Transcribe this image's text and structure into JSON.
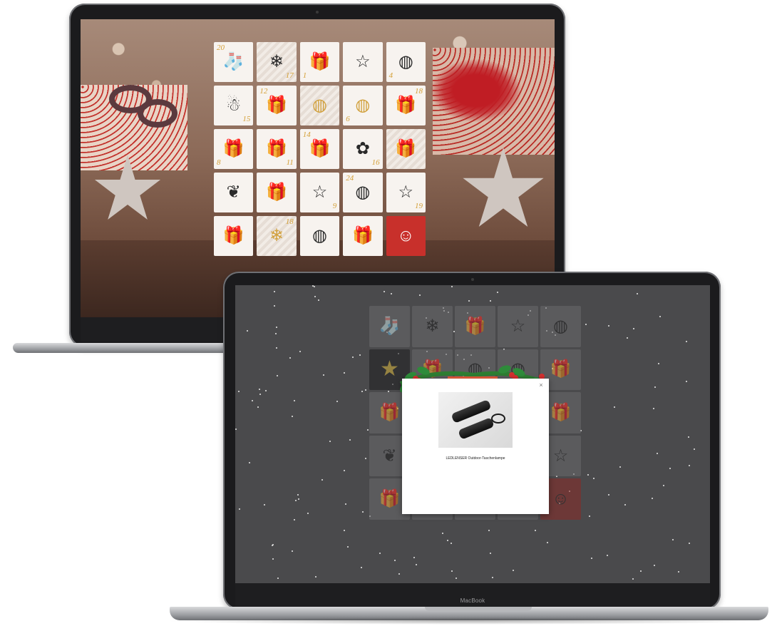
{
  "back_laptop": {
    "calendar": {
      "tiles": [
        {
          "number": "20",
          "icon": "stocking-icon",
          "glyph": "🧦",
          "style": "plain",
          "gold": false
        },
        {
          "number": "17",
          "icon": "ornament-icon",
          "glyph": "❄",
          "style": "striped",
          "gold": false
        },
        {
          "number": "1",
          "icon": "gift-icon",
          "glyph": "🎁",
          "style": "plain",
          "gold": false
        },
        {
          "number": "",
          "icon": "star-icon",
          "glyph": "☆",
          "style": "plain",
          "gold": false
        },
        {
          "number": "4",
          "icon": "bauble-icon",
          "glyph": "◍",
          "style": "plain",
          "gold": false
        },
        {
          "number": "15",
          "icon": "snowman-icon",
          "glyph": "☃",
          "style": "plain",
          "gold": false
        },
        {
          "number": "12",
          "icon": "gift-icon",
          "glyph": "🎁",
          "style": "plain",
          "gold": true
        },
        {
          "number": "",
          "icon": "bauble-icon",
          "glyph": "◍",
          "style": "striped",
          "gold": true
        },
        {
          "number": "6",
          "icon": "bauble-icon",
          "glyph": "◍",
          "style": "plain",
          "gold": true
        },
        {
          "number": "18",
          "icon": "gift-icon",
          "glyph": "🎁",
          "style": "plain",
          "gold": true
        },
        {
          "number": "8",
          "icon": "gift-icon",
          "glyph": "🎁",
          "style": "plain",
          "gold": true
        },
        {
          "number": "11",
          "icon": "gift-icon",
          "glyph": "🎁",
          "style": "plain",
          "gold": false
        },
        {
          "number": "14",
          "icon": "gift-icon",
          "glyph": "🎁",
          "style": "plain",
          "gold": false
        },
        {
          "number": "16",
          "icon": "garland-icon",
          "glyph": "✿",
          "style": "plain",
          "gold": false
        },
        {
          "number": "",
          "icon": "gift-icon",
          "glyph": "🎁",
          "style": "striped",
          "gold": false
        },
        {
          "number": "",
          "icon": "pinecone-icon",
          "glyph": "❦",
          "style": "plain",
          "gold": false
        },
        {
          "number": "",
          "icon": "gift-icon",
          "glyph": "🎁",
          "style": "plain",
          "gold": false
        },
        {
          "number": "9",
          "icon": "star-icon",
          "glyph": "☆",
          "style": "plain",
          "gold": false
        },
        {
          "number": "24",
          "icon": "bauble-icon",
          "glyph": "◍",
          "style": "plain",
          "gold": false
        },
        {
          "number": "19",
          "icon": "star-icon",
          "glyph": "☆",
          "style": "plain",
          "gold": false
        },
        {
          "number": "",
          "icon": "gift-icon",
          "glyph": "🎁",
          "style": "plain",
          "gold": true
        },
        {
          "number": "18",
          "icon": "snowflake-icon",
          "glyph": "❄",
          "style": "striped",
          "gold": true
        },
        {
          "number": "",
          "icon": "bauble-icon",
          "glyph": "◍",
          "style": "plain",
          "gold": false
        },
        {
          "number": "",
          "icon": "gift-icon",
          "glyph": "🎁",
          "style": "plain",
          "gold": false
        },
        {
          "number": "",
          "icon": "santa-icon",
          "glyph": "☺",
          "style": "red",
          "gold": false
        }
      ]
    }
  },
  "front_laptop": {
    "brand_label": "MacBook",
    "calendar": {
      "tiles": [
        {
          "icon": "stocking-icon",
          "glyph": "🧦",
          "style": "plain"
        },
        {
          "icon": "ornament-icon",
          "glyph": "❄",
          "style": "plain"
        },
        {
          "icon": "gift-icon",
          "glyph": "🎁",
          "style": "plain"
        },
        {
          "icon": "star-icon",
          "glyph": "☆",
          "style": "plain"
        },
        {
          "icon": "bauble-icon",
          "glyph": "◍",
          "style": "plain"
        },
        {
          "icon": "star-icon",
          "glyph": "★",
          "style": "dark"
        },
        {
          "icon": "gift-icon",
          "glyph": "🎁",
          "style": "plain"
        },
        {
          "icon": "bauble-icon",
          "glyph": "◍",
          "style": "plain"
        },
        {
          "icon": "bauble-icon",
          "glyph": "◍",
          "style": "plain"
        },
        {
          "icon": "gift-icon",
          "glyph": "🎁",
          "style": "plain"
        },
        {
          "icon": "gift-icon",
          "glyph": "🎁",
          "style": "plain"
        },
        {
          "icon": "gift-icon",
          "glyph": "🎁",
          "style": "plain"
        },
        {
          "icon": "gift-icon",
          "glyph": "🎁",
          "style": "plain"
        },
        {
          "icon": "garland-icon",
          "glyph": "✿",
          "style": "plain"
        },
        {
          "icon": "gift-icon",
          "glyph": "🎁",
          "style": "plain"
        },
        {
          "icon": "pinecone-icon",
          "glyph": "❦",
          "style": "plain"
        },
        {
          "icon": "gift-icon",
          "glyph": "🎁",
          "style": "plain"
        },
        {
          "icon": "star-icon",
          "glyph": "☆",
          "style": "plain"
        },
        {
          "icon": "bauble-icon",
          "glyph": "◍",
          "style": "plain"
        },
        {
          "icon": "star-icon",
          "glyph": "☆",
          "style": "plain"
        },
        {
          "icon": "gift-icon",
          "glyph": "🎁",
          "style": "plain"
        },
        {
          "icon": "snowflake-icon",
          "glyph": "❄",
          "style": "plain"
        },
        {
          "icon": "bauble-icon",
          "glyph": "◍",
          "style": "plain"
        },
        {
          "icon": "gift-icon",
          "glyph": "🎁",
          "style": "plain"
        },
        {
          "icon": "santa-icon",
          "glyph": "☺",
          "style": "red"
        }
      ]
    },
    "popup": {
      "caption": "LEDLENSER Outdoor-Taschenlampe",
      "close_glyph": "×"
    }
  }
}
